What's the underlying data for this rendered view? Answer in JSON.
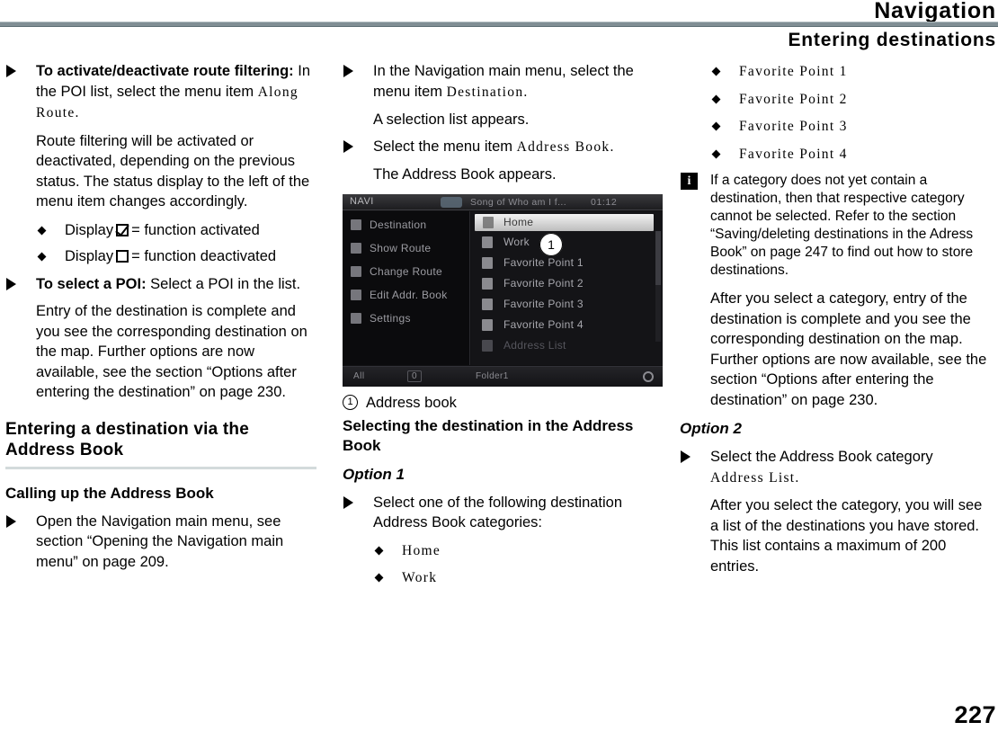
{
  "header": {
    "chapter": "Navigation",
    "section": "Entering destinations"
  },
  "page_number": "227",
  "col1": {
    "step1_bold": "To activate/deactivate route filtering:",
    "step1_text": " In the POI list, select the menu item ",
    "step1_ui": "Along Route",
    "step1_period": ".",
    "para1": "Route filtering will be activated or deactivated, depending on the previous status. The status display to the left of the menu item changes accordingly.",
    "bullet_display1_pre": "Display",
    "bullet_display1_post": "= function activated",
    "bullet_display2_pre": "Display",
    "bullet_display2_post": "= function deactivated",
    "step2_bold": "To select a POI:",
    "step2_text": " Select a POI in the list.",
    "para2": "Entry of the destination is complete and you see the corresponding destination on the map. Further options are now available, see the section “Options after entering the destination” on page 230.",
    "heading1": "Entering a destination via the Address Book",
    "heading2": "Calling up the Address Book",
    "step3": "Open the Navigation main menu, see section “Opening the Navigation main menu” on page 209."
  },
  "col2": {
    "step1_a": "In the Navigation main menu, select the menu item ",
    "step1_ui": "Destination",
    "step1_period": ".",
    "para1": "A selection list appears.",
    "step2_a": "Select the menu item ",
    "step2_ui": "Address Book",
    "step2_period": ".",
    "para2": "The Address Book appears.",
    "figure": {
      "navi_label": "NAVI",
      "track_title": "Song of Who am I f...",
      "track_time": "01:12",
      "left_menu": [
        "Destination",
        "Show Route",
        "Change Route",
        "Edit Addr. Book",
        "Settings"
      ],
      "right_menu": [
        "Home",
        "Work",
        "Favorite Point 1",
        "Favorite Point 2",
        "Favorite Point 3",
        "Favorite Point 4",
        "Address List"
      ],
      "callout_1": "1",
      "bottom_left": "All",
      "bottom_mid": "0",
      "bottom_label": "Folder1"
    },
    "figcap_num": "1",
    "figcap_text": "Address book",
    "heading1": "Selecting the destination in the Address Book",
    "heading_option1": "Option 1",
    "step3": "Select one of the following destination Address Book categories:",
    "bullet_home": "Home",
    "bullet_work": "Work"
  },
  "col3": {
    "bullets": [
      "Favorite Point 1",
      "Favorite Point 2",
      "Favorite Point 3",
      "Favorite Point 4"
    ],
    "note_icon": "i",
    "note_text": "If a category does not yet contain a destination, then that respective category cannot be selected. Refer to the section “Saving/deleting destinations in the Adress Book” on page 247 to find out how to store destinations.",
    "para1": "After you select a category, entry of the destination is complete and you see the corresponding destination on the map. Further options are now available, see the section “Options after entering the destination” on page 230.",
    "heading_option2": "Option 2",
    "step1_a": "Select the Address Book category",
    "step1_ui": "Address List",
    "step1_period": ".",
    "para2": "After you select the category, you will see a list of the destinations you have stored. This list contains a maximum of 200 entries."
  },
  "colors": {
    "header_rule": "#808e94",
    "section_rule": "#d3dadb"
  }
}
